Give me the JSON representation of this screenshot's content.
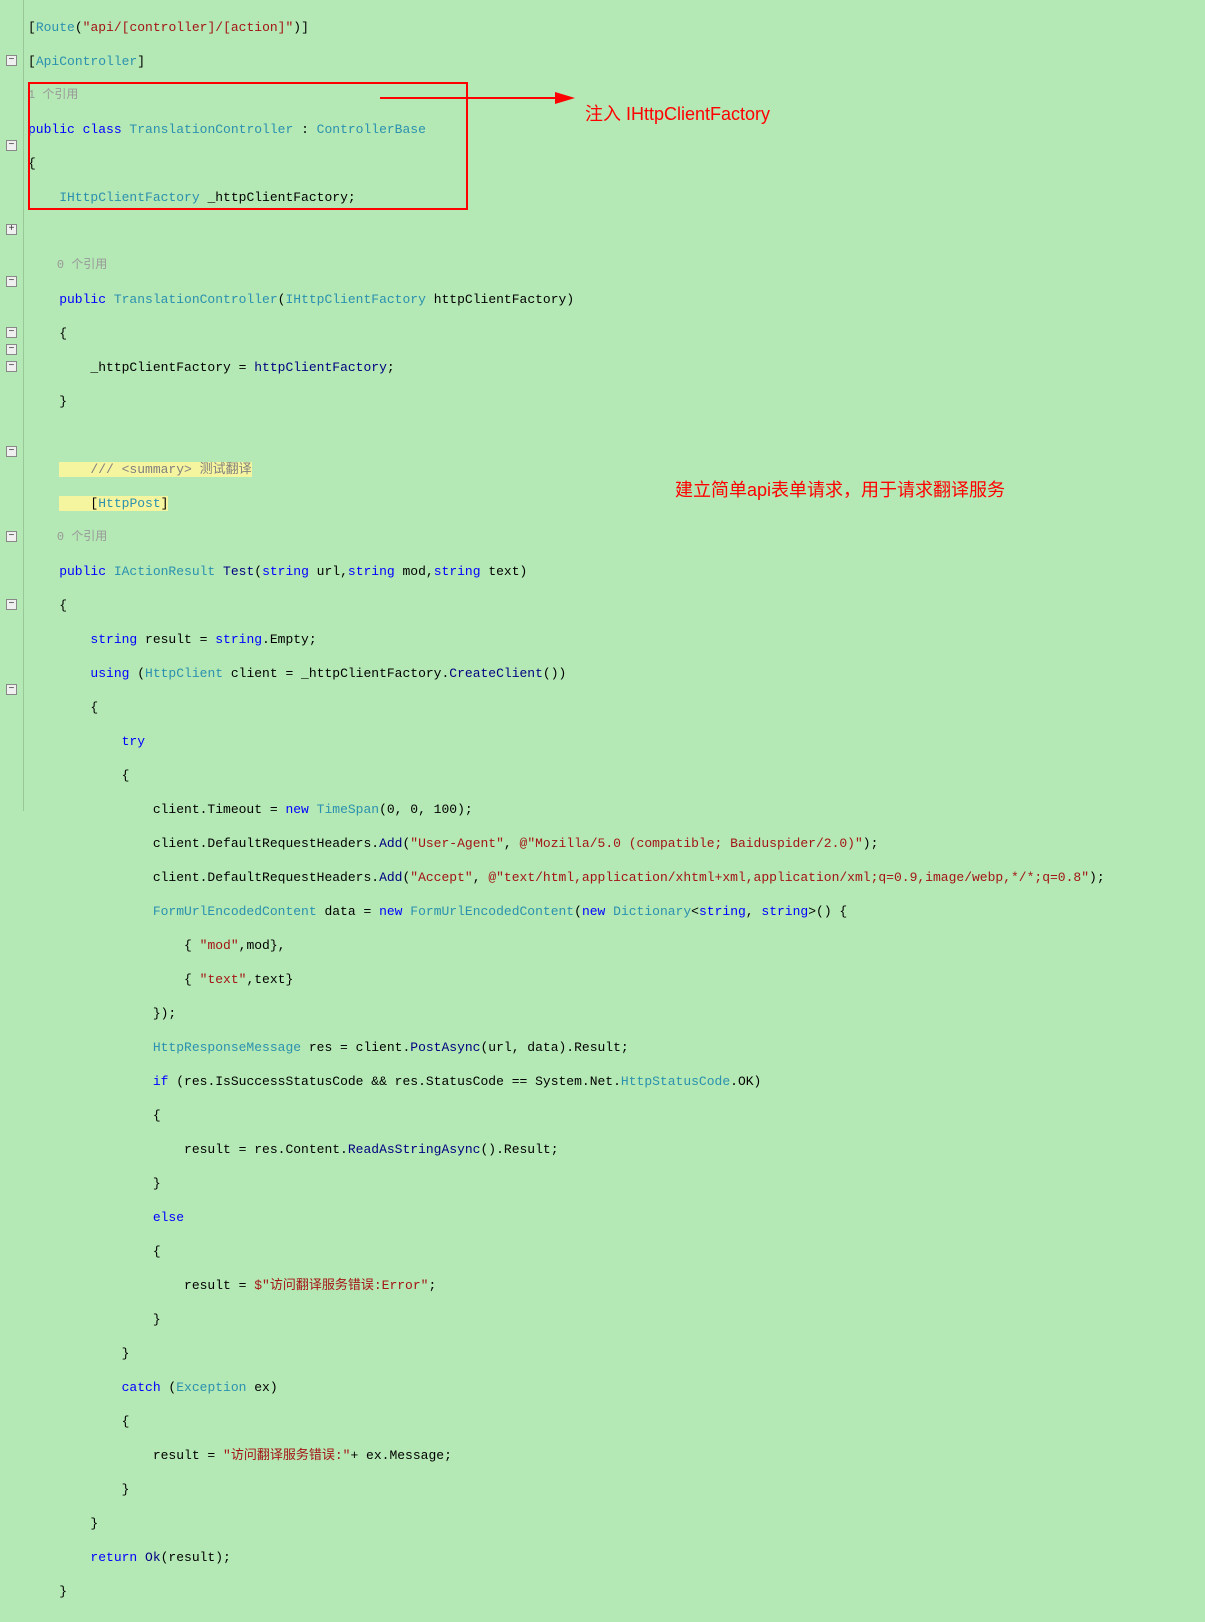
{
  "gutter": {
    "minus": "−",
    "plus": "+"
  },
  "refs": {
    "one": "1 个引用",
    "zero": "0 个引用"
  },
  "code": {
    "l1_a": "[",
    "l1_b": "Route",
    "l1_c": "(",
    "l1_d": "\"api/[controller]/[action]\"",
    "l1_e": ")]",
    "l2_a": "[",
    "l2_b": "ApiController",
    "l2_c": "]",
    "l4_a": "public",
    "l4_b": " class",
    "l4_c": " TranslationController",
    "l4_d": " : ",
    "l4_e": "ControllerBase",
    "l5": "{",
    "l6_a": "    IHttpClientFactory",
    "l6_b": " _httpClientFactory;",
    "l8_a": "    public",
    "l8_b": " TranslationController",
    "l8_c": "(",
    "l8_d": "IHttpClientFactory",
    "l8_e": " httpClientFactory)",
    "l9": "    {",
    "l10_a": "        _httpClientFactory = ",
    "l10_b": "httpClientFactory",
    "l10_c": ";",
    "l11": "    }",
    "l13_a": "    /// <summary>",
    "l13_b": " 测试翻译",
    "l14_a": "    [",
    "l14_b": "HttpPost",
    "l14_c": "]",
    "l16_a": "    public",
    "l16_b": " IActionResult",
    "l16_c": " Test",
    "l16_d": "(",
    "l16_e": "string",
    "l16_f": " url,",
    "l16_g": "string",
    "l16_h": " mod,",
    "l16_i": "string",
    "l16_j": " text)",
    "l17": "    {",
    "l18_a": "        string",
    "l18_b": " result = ",
    "l18_c": "string",
    "l18_d": ".Empty;",
    "l19_a": "        using",
    "l19_b": " (",
    "l19_c": "HttpClient",
    "l19_d": " client = _httpClientFactory.",
    "l19_e": "CreateClient",
    "l19_f": "())",
    "l20": "        {",
    "l21_a": "            try",
    "l22": "            {",
    "l23_a": "                client.Timeout = ",
    "l23_b": "new",
    "l23_c": " TimeSpan",
    "l23_d": "(0, 0, 100);",
    "l24_a": "                client.DefaultRequestHeaders.",
    "l24_b": "Add",
    "l24_c": "(",
    "l24_d": "\"User-Agent\"",
    "l24_e": ", ",
    "l24_f": "@\"Mozilla/5.0 (compatible; Baiduspider/2.0)\"",
    "l24_g": ");",
    "l25_a": "                client.DefaultRequestHeaders.",
    "l25_b": "Add",
    "l25_c": "(",
    "l25_d": "\"Accept\"",
    "l25_e": ", ",
    "l25_f": "@\"text/html,application/xhtml+xml,application/xml;q=0.9,image/webp,*/*;q=0.8\"",
    "l25_g": ");",
    "l26_a": "                FormUrlEncodedContent",
    "l26_b": " data = ",
    "l26_c": "new",
    "l26_d": " FormUrlEncodedContent",
    "l26_e": "(",
    "l26_f": "new",
    "l26_g": " Dictionary",
    "l26_h": "<",
    "l26_i": "string",
    "l26_j": ", ",
    "l26_k": "string",
    "l26_l": ">() {",
    "l27_a": "                    { ",
    "l27_b": "\"mod\"",
    "l27_c": ",mod},",
    "l28_a": "                    { ",
    "l28_b": "\"text\"",
    "l28_c": ",text}",
    "l29": "                });",
    "l30_a": "                HttpResponseMessage",
    "l30_b": " res = client.",
    "l30_c": "PostAsync",
    "l30_d": "(url, data).Result;",
    "l31_a": "                if",
    "l31_b": " (res.IsSuccessStatusCode && res.StatusCode == System.Net.",
    "l31_c": "HttpStatusCode",
    "l31_d": ".OK)",
    "l32": "                {",
    "l33_a": "                    result = res.Content.",
    "l33_b": "ReadAsStringAsync",
    "l33_c": "().Result;",
    "l34": "                }",
    "l35_a": "                else",
    "l36": "                {",
    "l37_a": "                    result = ",
    "l37_b": "$\"访问翻译服务错误:Error\"",
    "l37_c": ";",
    "l38": "                }",
    "l39": "            }",
    "l40_a": "            catch",
    "l40_b": " (",
    "l40_c": "Exception",
    "l40_d": " ex)",
    "l41": "            {",
    "l42_a": "                result = ",
    "l42_b": "\"访问翻译服务错误:\"",
    "l42_c": "+ ex.Message;",
    "l43": "            }",
    "l44": "        }",
    "l45_a": "        return",
    "l45_b": " Ok",
    "l45_c": "(result);",
    "l46": "    }"
  },
  "annotations": {
    "inject": "注入 IHttpClientFactory",
    "api": "建立简单api表单请求，用于请求翻译服务"
  }
}
